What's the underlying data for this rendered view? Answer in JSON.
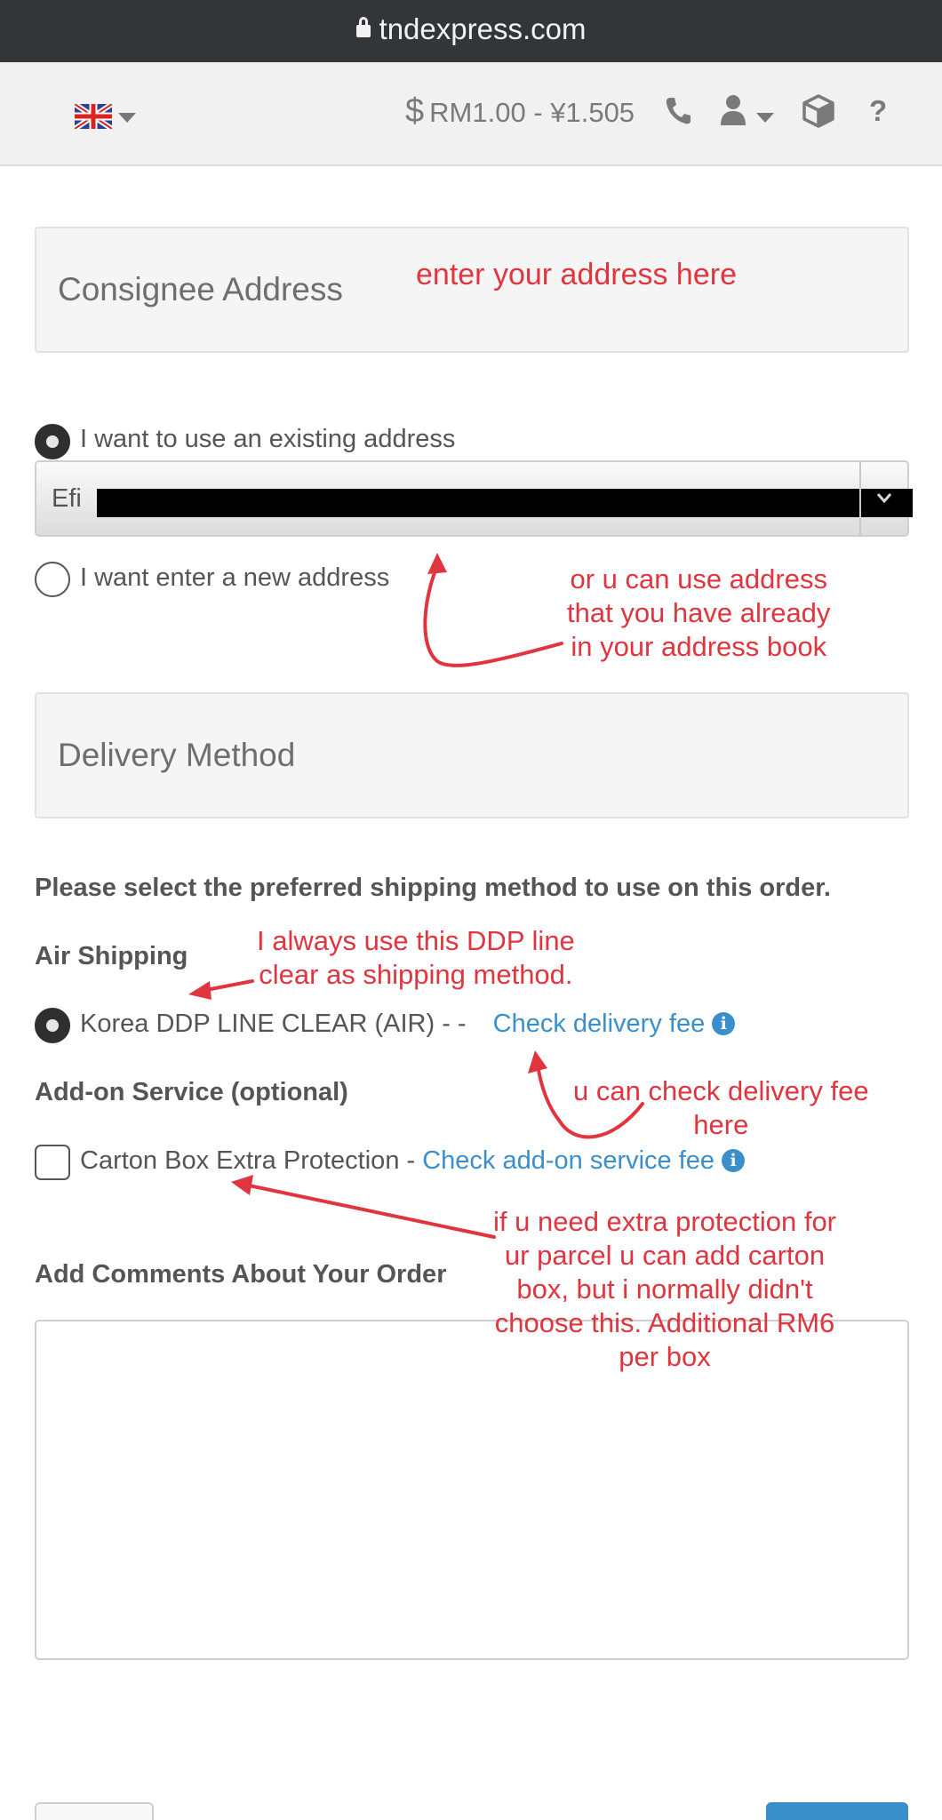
{
  "browser": {
    "url": "tndexpress.com"
  },
  "nav": {
    "exchange_rate": "RM1.00 - ¥1.505",
    "currency_symbol": "$",
    "icons": [
      "uk-flag-icon",
      "phone-icon",
      "user-icon",
      "package-icon",
      "help-icon"
    ],
    "help_label": "?"
  },
  "consignee": {
    "title": "Consignee Address",
    "option_existing": "I want to use an existing address",
    "selected_address": "Efi",
    "option_new": "I want enter a new address"
  },
  "delivery": {
    "title": "Delivery Method",
    "instruction": "Please select the preferred shipping method to use on this order.",
    "air_heading": "Air Shipping",
    "air_option": "Korea DDP LINE CLEAR (AIR) - -",
    "check_fee_link": "Check delivery fee",
    "addon_heading": "Add-on Service (optional)",
    "addon_option": "Carton Box Extra Protection -",
    "check_addon_link": "Check add-on service fee",
    "info_glyph": "i"
  },
  "comments": {
    "heading": "Add Comments About Your Order"
  },
  "annotations": {
    "address_note": "enter your address here",
    "existing_note_1": "or u can use address",
    "existing_note_2": "that you have already",
    "existing_note_3": "in your address book",
    "ddp_note_1": "I always use this DDP line",
    "ddp_note_2": "clear as shipping method.",
    "fee_note_1": "u can check delivery fee",
    "fee_note_2": "here",
    "carton_note_1": "if u need extra protection for",
    "carton_note_2": "ur parcel u can add carton",
    "carton_note_3": "box, but i normally didn't",
    "carton_note_4": "choose this. Additional RM6",
    "carton_note_5": "per box"
  },
  "colors": {
    "annotation": "#e0353f",
    "link": "#3a8fcb",
    "topbar": "#333538"
  }
}
